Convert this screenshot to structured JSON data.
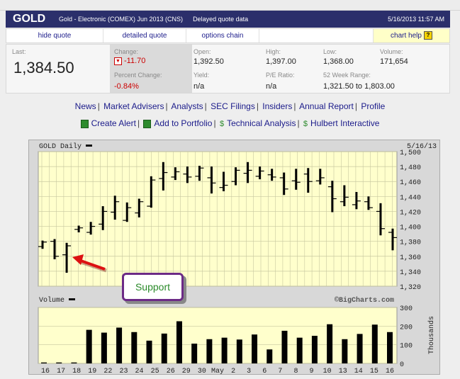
{
  "header": {
    "symbol": "GOLD",
    "name": "Gold - Electronic (COMEX) Jun 2013 (CNS)",
    "delayed": "Delayed quote data",
    "datetime": "5/16/2013 11:57 AM"
  },
  "tabs": [
    "hide quote",
    "detailed quote",
    "options chain",
    "",
    "chart help"
  ],
  "quote": {
    "last_label": "Last:",
    "last": "1,384.50",
    "change_label": "Change:",
    "change": "-11.70",
    "pct_label": "Percent Change:",
    "pct": "-0.84%",
    "open_label": "Open:",
    "open": "1,392.50",
    "high_label": "High:",
    "high": "1,397.00",
    "low_label": "Low:",
    "low": "1,368.00",
    "volume_label": "Volume:",
    "volume": "171,654",
    "yield_label": "Yield:",
    "yield": "n/a",
    "pe_label": "P/E Ratio:",
    "pe": "n/a",
    "range_label": "52 Week Range:",
    "range": "1,321.50 to 1,803.00"
  },
  "links_row1": [
    "News",
    "Market Advisers",
    "Analysts",
    "SEC Filings",
    "Insiders",
    "Annual Report",
    "Profile"
  ],
  "links_row2": [
    "Create Alert",
    "Add to Portfolio",
    "Technical Analysis",
    "Hulbert Interactive"
  ],
  "colors": {
    "header_bg": "#2b2f6b",
    "chart_bg": "#ffffcc",
    "grid": "#c8c8a0",
    "change_red": "#cc0000",
    "callout_border": "#6c2a86",
    "callout_text": "#2a8a2a",
    "arrow_red": "#dd1111"
  },
  "chart_data": {
    "type": "bar",
    "title": "GOLD Daily",
    "date": "5/16/13",
    "watermark": "©BigCharts.com",
    "price_axis": {
      "ylim": [
        1320,
        1500
      ],
      "ticks": [
        "1,500",
        "1,480",
        "1,460",
        "1,440",
        "1,420",
        "1,400",
        "1,380",
        "1,360",
        "1,340",
        "1,320"
      ]
    },
    "volume_label": "Volume",
    "volume_axis": {
      "label": "Thousands",
      "ylim": [
        0,
        300
      ],
      "ticks": [
        "300",
        "200",
        "100",
        "0"
      ]
    },
    "x_labels": [
      "16",
      "17",
      "18",
      "19",
      "22",
      "23",
      "24",
      "25",
      "26",
      "29",
      "30",
      "May",
      "2",
      "3",
      "6",
      "7",
      "8",
      "9",
      "10",
      "13",
      "14",
      "15",
      "16"
    ],
    "ohlc": [
      {
        "high": 1381,
        "low": 1370,
        "open": 1373,
        "close": 1379
      },
      {
        "high": 1383,
        "low": 1356,
        "open": 1380,
        "close": 1360
      },
      {
        "high": 1378,
        "low": 1338,
        "open": 1362,
        "close": 1374
      },
      {
        "high": 1401,
        "low": 1392,
        "open": 1396,
        "close": 1398
      },
      {
        "high": 1406,
        "low": 1389,
        "open": 1392,
        "close": 1400
      },
      {
        "high": 1427,
        "low": 1395,
        "open": 1403,
        "close": 1420
      },
      {
        "high": 1441,
        "low": 1409,
        "open": 1419,
        "close": 1433
      },
      {
        "high": 1432,
        "low": 1406,
        "open": 1408,
        "close": 1425
      },
      {
        "high": 1437,
        "low": 1412,
        "open": 1418,
        "close": 1433
      },
      {
        "high": 1467,
        "low": 1425,
        "open": 1427,
        "close": 1462
      },
      {
        "high": 1486,
        "low": 1448,
        "open": 1464,
        "close": 1472
      },
      {
        "high": 1479,
        "low": 1462,
        "open": 1466,
        "close": 1473
      },
      {
        "high": 1480,
        "low": 1458,
        "open": 1470,
        "close": 1466
      },
      {
        "high": 1481,
        "low": 1461,
        "open": 1467,
        "close": 1478
      },
      {
        "high": 1480,
        "low": 1444,
        "open": 1465,
        "close": 1458
      },
      {
        "high": 1473,
        "low": 1447,
        "open": 1452,
        "close": 1455
      },
      {
        "high": 1479,
        "low": 1455,
        "open": 1460,
        "close": 1475
      },
      {
        "high": 1486,
        "low": 1458,
        "open": 1471,
        "close": 1475
      },
      {
        "high": 1480,
        "low": 1463,
        "open": 1467,
        "close": 1474
      },
      {
        "high": 1477,
        "low": 1461,
        "open": 1469,
        "close": 1466
      },
      {
        "high": 1472,
        "low": 1442,
        "open": 1465,
        "close": 1450
      },
      {
        "high": 1477,
        "low": 1449,
        "open": 1461,
        "close": 1459
      },
      {
        "high": 1478,
        "low": 1445,
        "open": 1470,
        "close": 1460
      },
      {
        "high": 1477,
        "low": 1456,
        "open": 1461,
        "close": 1465
      },
      {
        "high": 1461,
        "low": 1419,
        "open": 1453,
        "close": 1437
      },
      {
        "high": 1455,
        "low": 1427,
        "open": 1433,
        "close": 1439
      },
      {
        "high": 1446,
        "low": 1423,
        "open": 1429,
        "close": 1434
      },
      {
        "high": 1440,
        "low": 1422,
        "open": 1433,
        "close": 1425
      },
      {
        "high": 1431,
        "low": 1388,
        "open": 1420,
        "close": 1397
      },
      {
        "high": 1397,
        "low": 1368,
        "open": 1392,
        "close": 1385
      }
    ],
    "volumes": [
      5,
      5,
      5,
      180,
      165,
      192,
      168,
      122,
      160,
      226,
      106,
      130,
      138,
      128,
      155,
      75,
      175,
      138,
      148,
      210,
      130,
      158,
      208,
      168
    ]
  },
  "callout": {
    "text": "Support"
  }
}
